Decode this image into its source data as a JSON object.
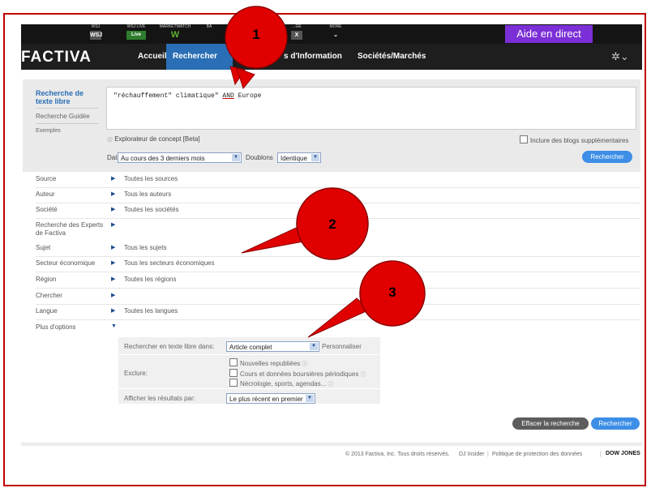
{
  "top_strip": {
    "items": [
      {
        "label": "WSJ",
        "icon_text": "WSJ"
      },
      {
        "label": "WSJ LIVE",
        "icon_text": "Live"
      },
      {
        "label": "MARKETWATCH",
        "icon_text": "W"
      },
      {
        "label": "BA",
        "icon_text": ""
      },
      {
        "label": "...GE",
        "icon_text": "X"
      },
      {
        "label": "MORE",
        "icon_text": "⌄"
      }
    ],
    "aide_button": "Aide en direct"
  },
  "nav": {
    "logo": "FACTIVA",
    "items": [
      "Accueil",
      "Rechercher",
      "s d'Information",
      "Sociétés/Marchés"
    ],
    "settings_icon": "gear-icon"
  },
  "search_panel": {
    "left_nav": {
      "free_text_title": "Recherche de texte libre",
      "guided": "Recherche Guidée",
      "examples": "Exemples"
    },
    "query_parts": [
      "\"réchauffement\" climatique\" ",
      "AND",
      " Europe"
    ],
    "concept_explorer": "Explorateur de concept [Beta]",
    "include_blogs": "Inclure des blogs supplémentaires",
    "date_label": "Date",
    "date_value": "Au cours des 3 derniers mois",
    "duplicates_label": "Doublons",
    "duplicates_value": "Identique",
    "search_button": "Rechercher"
  },
  "filters": [
    {
      "label": "Source",
      "value": "Toutes les sources"
    },
    {
      "label": "Auteur",
      "value": "Tous les auteurs"
    },
    {
      "label": "Société",
      "value": "Toutes les sociétés"
    },
    {
      "label": "Recherche des Experts de Factiva",
      "value": ""
    },
    {
      "label": "Sujet",
      "value": "Tous les sujets"
    },
    {
      "label": "Secteur économique",
      "value": "Tous les secteurs économiques"
    },
    {
      "label": "Région",
      "value": "Toutes les régions"
    },
    {
      "label": "Chercher",
      "value": ""
    },
    {
      "label": "Langue",
      "value": "Toutes les langues"
    },
    {
      "label": "Plus d'options",
      "value": ""
    }
  ],
  "more_options": {
    "search_in_label": "Rechercher en texte libre dans:",
    "search_in_value": "Article complet",
    "personalize": "Personnaliser",
    "exclude_label": "Exclure:",
    "exclude_items": [
      "Nouvelles republiées",
      "Cours et données boursières périodiques",
      "Nécrologie, sports, agendas..."
    ],
    "display_label": "Afficher les résultats par:",
    "display_value": "Le plus récent en premier"
  },
  "buttons": {
    "clear": "Effacer la recherche",
    "search": "Rechercher"
  },
  "footer": {
    "copyright": "© 2013 Factiva, Inc. Tous droits réservés.",
    "dj_insider": "DJ Insider",
    "privacy": "Politique de protection des données",
    "brand": "DOW JONES"
  },
  "callouts": [
    "1",
    "2",
    "3"
  ],
  "colors": {
    "callout": "#e00000",
    "nav_active": "#2a6eb5",
    "aide": "#7b2fd6",
    "button": "#3d8ee6"
  }
}
